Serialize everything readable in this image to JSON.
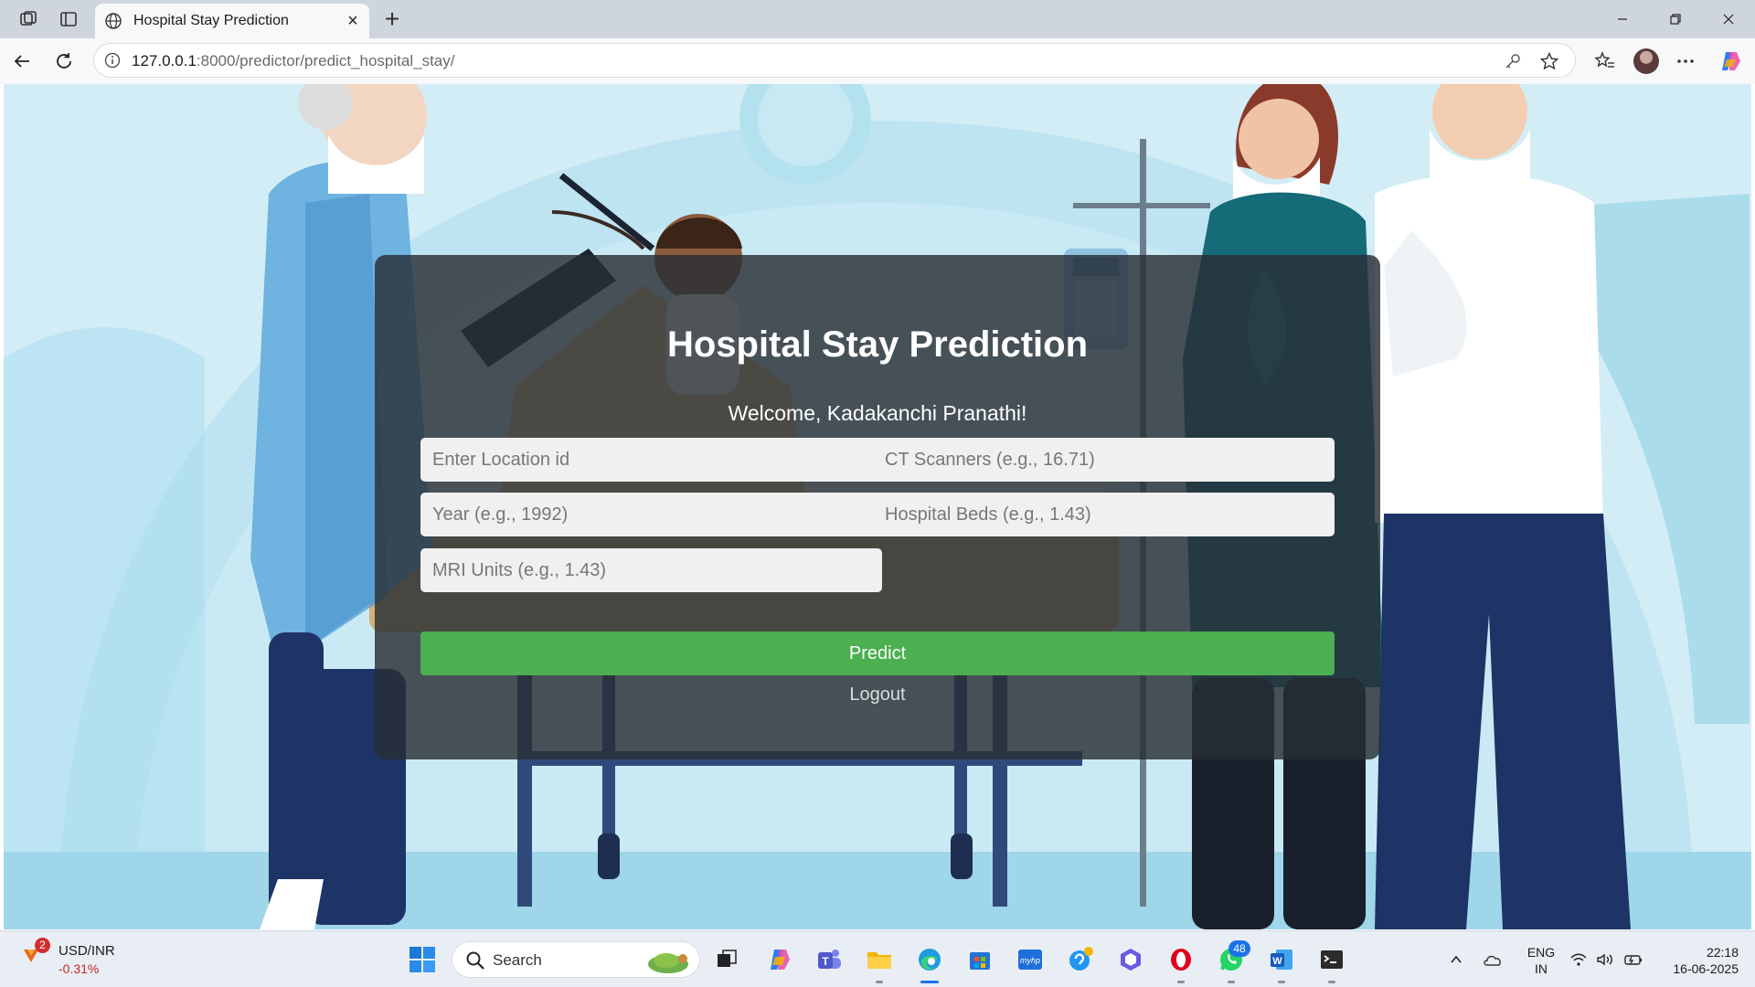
{
  "browser": {
    "tab_title": "Hospital Stay Prediction",
    "url_host": "127.0.0.1",
    "url_path": ":8000/predictor/predict_hospital_stay/"
  },
  "page": {
    "title": "Hospital Stay Prediction",
    "welcome": "Welcome, Kadakanchi Pranathi!",
    "fields": {
      "location_placeholder": "Enter Location id",
      "ct_placeholder": "CT Scanners (e.g., 16.71)",
      "year_placeholder": "Year (e.g., 1992)",
      "beds_placeholder": "Hospital Beds (e.g., 1.43)",
      "mri_placeholder": "MRI Units (e.g., 1.43)"
    },
    "predict_label": "Predict",
    "logout_label": "Logout",
    "colors": {
      "card": "#282e34",
      "predict": "#4caf50",
      "background": "#d5eef7"
    }
  },
  "taskbar": {
    "ticker_name": "USD/INR",
    "ticker_change": "-0.31%",
    "weather_badge": "2",
    "search_label": "Search",
    "whatsapp_badge": "48",
    "lang_line1": "ENG",
    "lang_line2": "IN",
    "time": "22:18",
    "date": "16-06-2025"
  }
}
